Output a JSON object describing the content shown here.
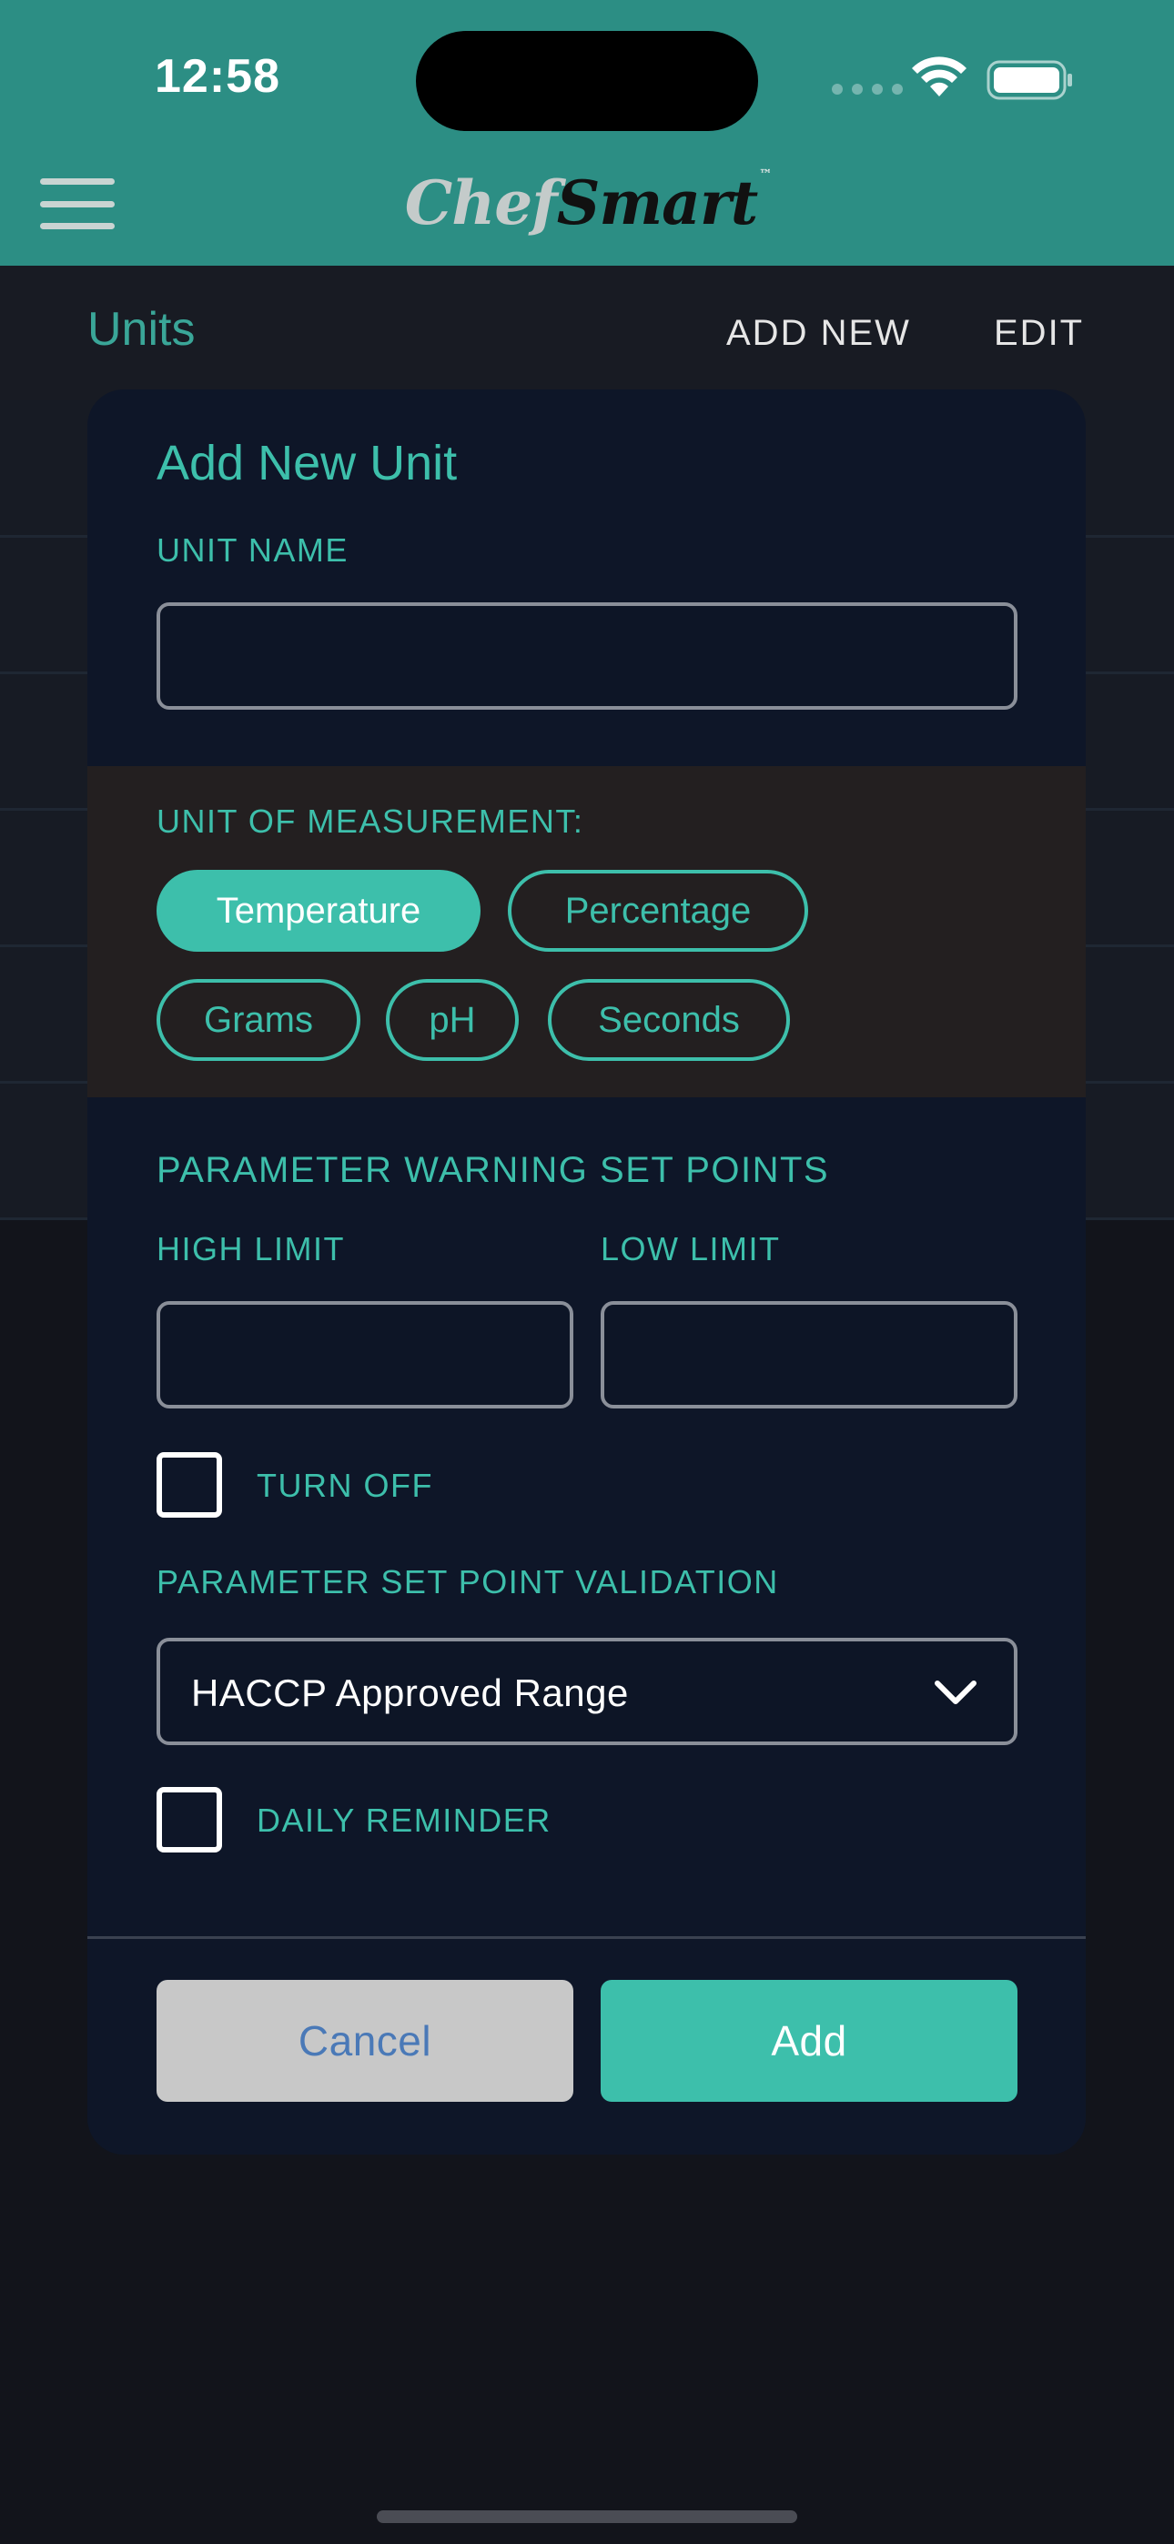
{
  "status_bar": {
    "time": "12:58"
  },
  "header": {
    "logo_text_1": "Chef",
    "logo_text_2": "Smart",
    "logo_tm": "™"
  },
  "subheader": {
    "title": "Units",
    "add_new": "ADD NEW",
    "edit": "EDIT"
  },
  "modal": {
    "title": "Add New Unit",
    "unit_name_label": "UNIT NAME",
    "unit_name_value": "",
    "measurement_label": "UNIT OF MEASUREMENT:",
    "measurement_options": [
      {
        "label": "Temperature",
        "selected": true
      },
      {
        "label": "Percentage",
        "selected": false
      },
      {
        "label": "Grams",
        "selected": false
      },
      {
        "label": "pH",
        "selected": false
      },
      {
        "label": "Seconds",
        "selected": false
      }
    ],
    "warning_heading": "PARAMETER WARNING SET POINTS",
    "high_limit_label": "HIGH LIMIT",
    "low_limit_label": "LOW LIMIT",
    "high_limit_value": "",
    "low_limit_value": "",
    "turn_off_label": "TURN OFF",
    "turn_off_checked": false,
    "validation_label": "PARAMETER SET POINT VALIDATION",
    "validation_selected": "HACCP Approved Range",
    "daily_reminder_label": "DAILY REMINDER",
    "daily_reminder_checked": false,
    "cancel_label": "Cancel",
    "add_label": "Add"
  },
  "colors": {
    "header_bg": "#2c8e84",
    "accent": "#3dbfab",
    "modal_bg": "#0e1628",
    "page_bg": "#12141b",
    "cancel_bg": "#c8c8c8",
    "cancel_text": "#4a79b7"
  },
  "icons": [
    "menu-icon",
    "wifi-icon",
    "battery-icon",
    "chevron-down-icon",
    "checkbox-icon"
  ]
}
